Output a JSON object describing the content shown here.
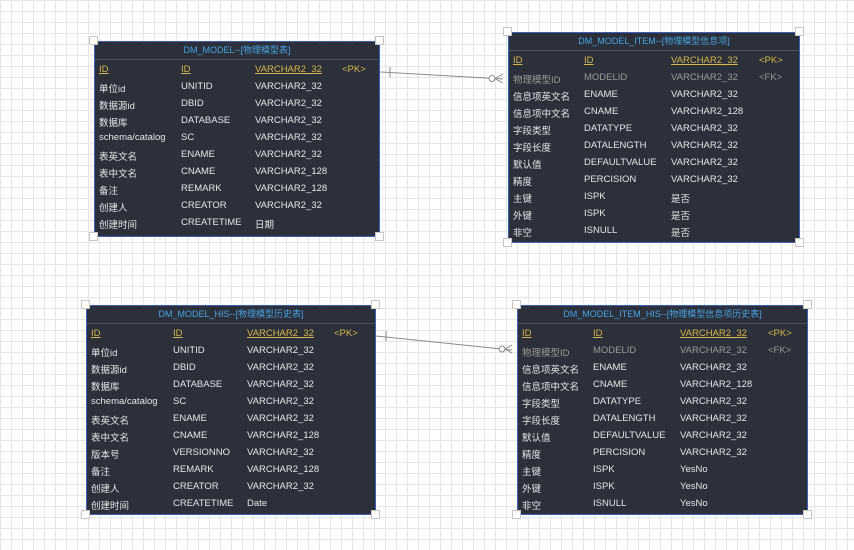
{
  "entities": [
    {
      "title": "DM_MODEL--[物理模型表]",
      "rows": [
        {
          "kind": "pk",
          "c1": "ID",
          "c2": "ID",
          "c3": "VARCHAR2_32",
          "c4": "<PK>"
        },
        {
          "kind": "",
          "c1": "单位id",
          "c2": "UNITID",
          "c3": "VARCHAR2_32",
          "c4": ""
        },
        {
          "kind": "",
          "c1": "数据源id",
          "c2": "DBID",
          "c3": "VARCHAR2_32",
          "c4": ""
        },
        {
          "kind": "",
          "c1": "数据库",
          "c2": "DATABASE",
          "c3": "VARCHAR2_32",
          "c4": ""
        },
        {
          "kind": "",
          "c1": "schema/catalog",
          "c2": "SC",
          "c3": "VARCHAR2_32",
          "c4": ""
        },
        {
          "kind": "",
          "c1": "表英文名",
          "c2": "ENAME",
          "c3": "VARCHAR2_32",
          "c4": ""
        },
        {
          "kind": "",
          "c1": "表中文名",
          "c2": "CNAME",
          "c3": "VARCHAR2_128",
          "c4": ""
        },
        {
          "kind": "",
          "c1": "备注",
          "c2": "REMARK",
          "c3": "VARCHAR2_128",
          "c4": ""
        },
        {
          "kind": "",
          "c1": "创建人",
          "c2": "CREATOR",
          "c3": "VARCHAR2_32",
          "c4": ""
        },
        {
          "kind": "",
          "c1": "创建时间",
          "c2": "CREATETIME",
          "c3": "日期",
          "c4": ""
        }
      ]
    },
    {
      "title": "DM_MODEL_ITEM--[物理模型信息项]",
      "rows": [
        {
          "kind": "pk",
          "c1": "ID",
          "c2": "ID",
          "c3": "VARCHAR2_32",
          "c4": "<PK>"
        },
        {
          "kind": "fk",
          "c1": "物理模型ID",
          "c2": "MODELID",
          "c3": "VARCHAR2_32",
          "c4": "<FK>"
        },
        {
          "kind": "",
          "c1": "信息项英文名",
          "c2": "ENAME",
          "c3": "VARCHAR2_32",
          "c4": ""
        },
        {
          "kind": "",
          "c1": "信息项中文名",
          "c2": "CNAME",
          "c3": "VARCHAR2_128",
          "c4": ""
        },
        {
          "kind": "",
          "c1": "字段类型",
          "c2": "DATATYPE",
          "c3": "VARCHAR2_32",
          "c4": ""
        },
        {
          "kind": "",
          "c1": "字段长度",
          "c2": "DATALENGTH",
          "c3": "VARCHAR2_32",
          "c4": ""
        },
        {
          "kind": "",
          "c1": "默认值",
          "c2": "DEFAULTVALUE",
          "c3": "VARCHAR2_32",
          "c4": ""
        },
        {
          "kind": "",
          "c1": "精度",
          "c2": "PERCISION",
          "c3": "VARCHAR2_32",
          "c4": ""
        },
        {
          "kind": "",
          "c1": "主键",
          "c2": "ISPK",
          "c3": "是否",
          "c4": ""
        },
        {
          "kind": "",
          "c1": "外键",
          "c2": "ISPK",
          "c3": "是否",
          "c4": ""
        },
        {
          "kind": "",
          "c1": "非空",
          "c2": "ISNULL",
          "c3": "是否",
          "c4": ""
        }
      ]
    },
    {
      "title": "DM_MODEL_HIS--[物理模型历史表]",
      "rows": [
        {
          "kind": "pk",
          "c1": "ID",
          "c2": "ID",
          "c3": "VARCHAR2_32",
          "c4": "<PK>"
        },
        {
          "kind": "",
          "c1": "单位id",
          "c2": "UNITID",
          "c3": "VARCHAR2_32",
          "c4": ""
        },
        {
          "kind": "",
          "c1": "数据源id",
          "c2": "DBID",
          "c3": "VARCHAR2_32",
          "c4": ""
        },
        {
          "kind": "",
          "c1": "数据库",
          "c2": "DATABASE",
          "c3": "VARCHAR2_32",
          "c4": ""
        },
        {
          "kind": "",
          "c1": "schema/catalog",
          "c2": "SC",
          "c3": "VARCHAR2_32",
          "c4": ""
        },
        {
          "kind": "",
          "c1": "表英文名",
          "c2": "ENAME",
          "c3": "VARCHAR2_32",
          "c4": ""
        },
        {
          "kind": "",
          "c1": "表中文名",
          "c2": "CNAME",
          "c3": "VARCHAR2_128",
          "c4": ""
        },
        {
          "kind": "",
          "c1": "版本号",
          "c2": "VERSIONNO",
          "c3": "VARCHAR2_32",
          "c4": ""
        },
        {
          "kind": "",
          "c1": "备注",
          "c2": "REMARK",
          "c3": "VARCHAR2_128",
          "c4": ""
        },
        {
          "kind": "",
          "c1": "创建人",
          "c2": "CREATOR",
          "c3": "VARCHAR2_32",
          "c4": ""
        },
        {
          "kind": "",
          "c1": "创建时间",
          "c2": "CREATETIME",
          "c3": "Date",
          "c4": ""
        }
      ]
    },
    {
      "title": "DM_MODEL_ITEM_HIS--[物理模型信息项历史表]",
      "rows": [
        {
          "kind": "pk",
          "c1": "ID",
          "c2": "ID",
          "c3": "VARCHAR2_32",
          "c4": "<PK>"
        },
        {
          "kind": "fk",
          "c1": "物理模型ID",
          "c2": "MODELID",
          "c3": "VARCHAR2_32",
          "c4": "<FK>"
        },
        {
          "kind": "",
          "c1": "信息项英文名",
          "c2": "ENAME",
          "c3": "VARCHAR2_32",
          "c4": ""
        },
        {
          "kind": "",
          "c1": "信息项中文名",
          "c2": "CNAME",
          "c3": "VARCHAR2_128",
          "c4": ""
        },
        {
          "kind": "",
          "c1": "字段类型",
          "c2": "DATATYPE",
          "c3": "VARCHAR2_32",
          "c4": ""
        },
        {
          "kind": "",
          "c1": "字段长度",
          "c2": "DATALENGTH",
          "c3": "VARCHAR2_32",
          "c4": ""
        },
        {
          "kind": "",
          "c1": "默认值",
          "c2": "DEFAULTVALUE",
          "c3": "VARCHAR2_32",
          "c4": ""
        },
        {
          "kind": "",
          "c1": "精度",
          "c2": "PERCISION",
          "c3": "VARCHAR2_32",
          "c4": ""
        },
        {
          "kind": "",
          "c1": "主键",
          "c2": "ISPK",
          "c3": "YesNo",
          "c4": ""
        },
        {
          "kind": "",
          "c1": "外键",
          "c2": "ISPK",
          "c3": "YesNo",
          "c4": ""
        },
        {
          "kind": "",
          "c1": "非空",
          "c2": "ISNULL",
          "c3": "YesNo",
          "c4": ""
        }
      ]
    }
  ],
  "colors": {
    "entity_bg": "#2b303b",
    "title": "#4aa3df",
    "pk": "#d9b64a",
    "fk": "#9a9a9a",
    "text": "#e4e6ea",
    "border": "#3f5fb5"
  }
}
